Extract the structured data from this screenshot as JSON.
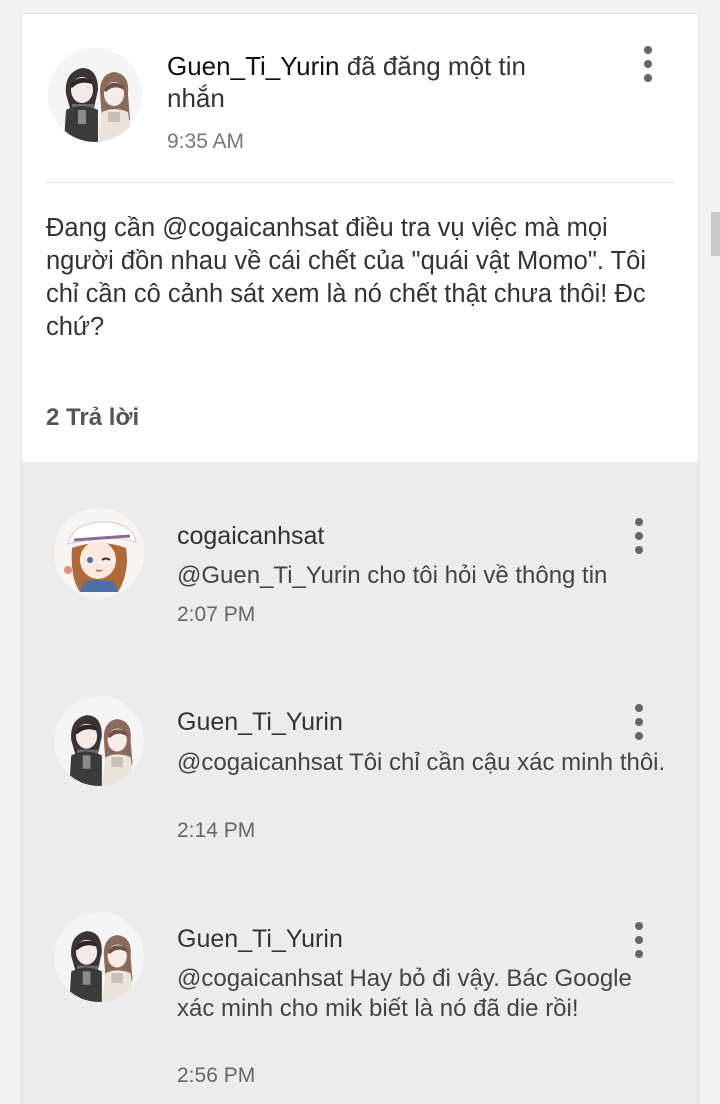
{
  "post": {
    "author": "Guen_Ti_Yurin",
    "action": " đã đăng một tin nhắn",
    "time": "9:35 AM",
    "body": "Đang cần @cogaicanhsat điều tra vụ việc mà mọi người đồn nhau về cái chết của \"quái vật Momo\". Tôi chỉ cần cô cảnh sát xem là nó chết thật chưa thôi! Đc chứ?",
    "avatar_icon": "couple-avatar-icon",
    "more_icon": "more-vertical-icon"
  },
  "replies_header": "2 Trả lời",
  "replies": [
    {
      "name": "cogaicanhsat",
      "text": "@Guen_Ti_Yurin  cho tôi hỏi về thông tin",
      "time": "2:07 PM",
      "avatar_icon": "girl-with-hat-avatar-icon"
    },
    {
      "name": "Guen_Ti_Yurin",
      "text": "@cogaicanhsat Tôi chỉ cần cậu xác minh thôi.",
      "time": "2:14 PM",
      "avatar_icon": "couple-avatar-icon"
    },
    {
      "name": "Guen_Ti_Yurin",
      "text": "@cogaicanhsat Hay bỏ đi vậy. Bác Google xác minh cho mik biết là nó đã die rồi!",
      "time": "2:56 PM",
      "avatar_icon": "couple-avatar-icon"
    }
  ],
  "colors": {
    "background": "#f2f2f2",
    "card": "#ffffff",
    "replies_background": "#ececec",
    "text": "#333333",
    "muted": "#777777"
  }
}
